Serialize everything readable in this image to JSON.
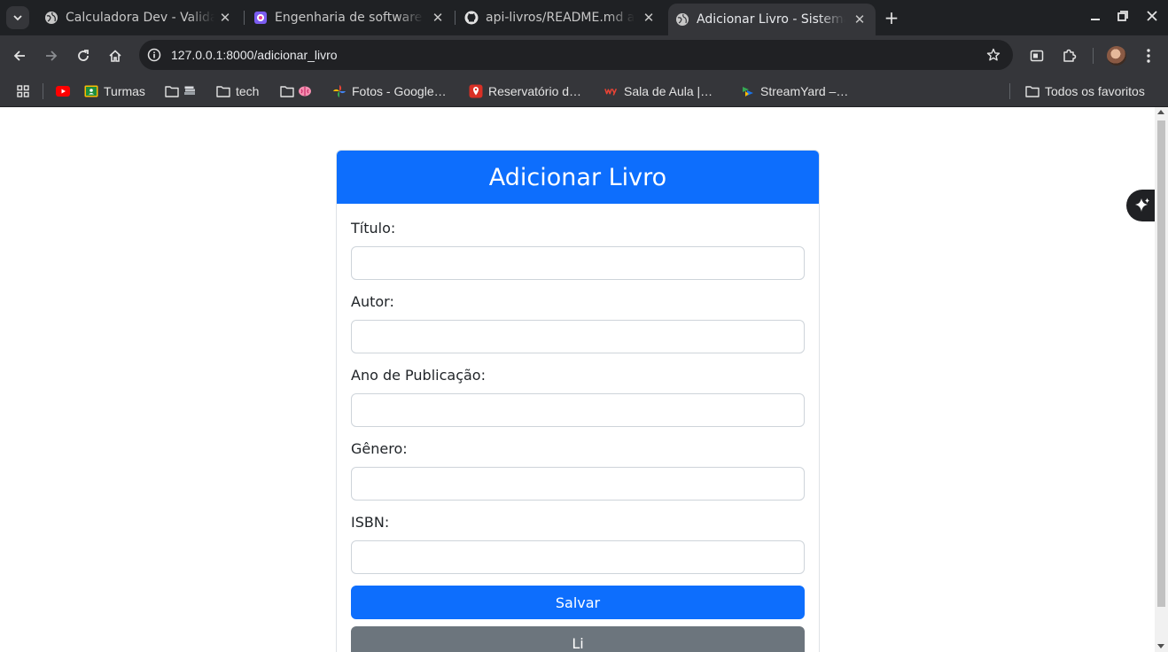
{
  "browser": {
    "tabs": [
      {
        "title": "Calculadora Dev - Validação",
        "icon": "globe-icon",
        "active": false
      },
      {
        "title": "Engenharia de software",
        "icon": "app-badge-icon",
        "active": false
      },
      {
        "title": "api-livros/README.md at main",
        "icon": "github-icon",
        "active": false
      },
      {
        "title": "Adicionar Livro - Sistema",
        "icon": "globe-icon",
        "active": true
      }
    ],
    "url": "127.0.0.1:8000/adicionar_livro",
    "bookmarks": [
      {
        "label": "",
        "icon": "youtube-icon"
      },
      {
        "label": "Turmas",
        "icon": "classroom-icon"
      },
      {
        "label": "",
        "icon": "folder-books-icon"
      },
      {
        "label": "tech",
        "icon": "folder-icon"
      },
      {
        "label": "",
        "icon": "folder-brain-icon"
      },
      {
        "label": "Fotos - Google…",
        "icon": "google-photos-icon"
      },
      {
        "label": "Reservatório d…",
        "icon": "map-pin-icon"
      },
      {
        "label": "Sala de Aula |…",
        "icon": "wy-icon"
      },
      {
        "label": "StreamYard –…",
        "icon": "streamyard-icon"
      }
    ],
    "all_bookmarks": "Todos os favoritos"
  },
  "form": {
    "title": "Adicionar Livro",
    "fields": [
      {
        "label": "Título:",
        "value": ""
      },
      {
        "label": "Autor:",
        "value": ""
      },
      {
        "label": "Ano de Publicação:",
        "value": ""
      },
      {
        "label": "Gênero:",
        "value": ""
      },
      {
        "label": "ISBN:",
        "value": ""
      }
    ],
    "submit_label": "Salvar",
    "secondary_label": "Li"
  },
  "colors": {
    "primary": "#0d6efd",
    "secondary": "#6c757d",
    "chrome_dark": "#1f2124",
    "chrome_toolbar": "#35363a"
  }
}
